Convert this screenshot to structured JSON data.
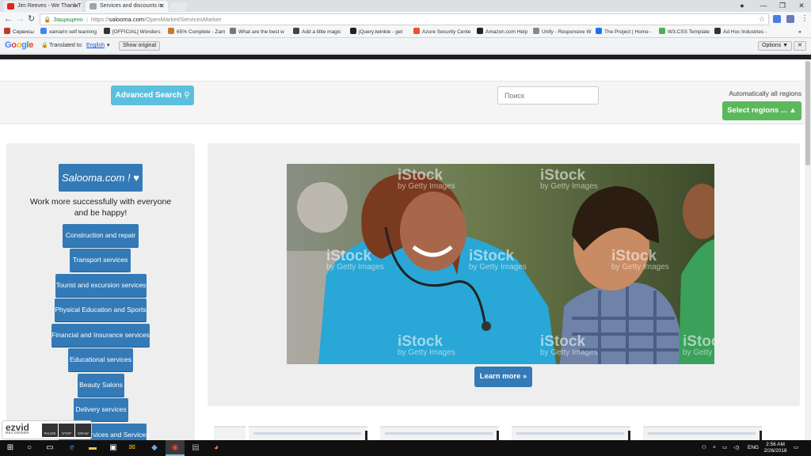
{
  "browser": {
    "tabs": [
      {
        "title": "Jim Reeves - We Thank T",
        "active": false,
        "favicon_color": "#e62117"
      },
      {
        "title": "Services and discounts in",
        "active": true,
        "favicon_color": "#9aa5b1"
      }
    ],
    "url": {
      "secure_label": "Защищено",
      "scheme": "https://",
      "host": "salooma.com",
      "path": "/OpenMarket/ServicesMarket"
    },
    "bookmarks": [
      {
        "label": "Сервисы",
        "icon_color": "#c0392b"
      },
      {
        "label": "xamarin self learning",
        "icon_color": "#4285f4"
      },
      {
        "label": "[OFFICIAL] Wonders",
        "icon_color": "#333333"
      },
      {
        "label": "65% Complete - Zam",
        "icon_color": "#c97b2a"
      },
      {
        "label": "What are the best w",
        "icon_color": "#777777"
      },
      {
        "label": "Add a little magic",
        "icon_color": "#444444"
      },
      {
        "label": "jQuery.twinkle - get",
        "icon_color": "#222222"
      },
      {
        "label": "Azure Security Cente",
        "icon_color": "#f25022"
      },
      {
        "label": "Amazon.com Help",
        "icon_color": "#222222"
      },
      {
        "label": "Unify - Responsive W",
        "icon_color": "#888888"
      },
      {
        "label": "The Project | Home -",
        "icon_color": "#1a73e8"
      },
      {
        "label": "W3.CSS Template",
        "icon_color": "#4caf50"
      },
      {
        "label": "Ad Hoc Industries -",
        "icon_color": "#333333"
      }
    ],
    "translate": {
      "translated_to": "Translated to:",
      "language": "English",
      "show_original": "Show original",
      "options": "Options ▼"
    }
  },
  "page": {
    "advanced_search_label": "Advanced Search",
    "search_placeholder": "Поиск",
    "regions_label": "Automatically all regions",
    "select_regions_label": "Select regions ...",
    "brand_label": "Salooma.com !",
    "tagline": "Work more successfully with everyone and be happy!",
    "categories": [
      "Construction and repair",
      "Transport services",
      "Tourist and excursion services",
      "Physical Education and Sports",
      "Financial and Insurance services",
      "Educational services",
      "Beauty Salons",
      "Delivery services",
      "Medical services and Services"
    ],
    "hero_watermark": "iStock",
    "hero_watermark_sub": "by Getty Images",
    "learn_more_label": "Learn more »"
  },
  "recorder": {
    "logo": "ezvid",
    "sub": "RECORDER",
    "buttons": [
      "PAUSE",
      "STOP",
      "DRAW"
    ]
  },
  "taskbar": {
    "language": "ENG",
    "time": "2:56 AM",
    "date": "2/26/2018"
  },
  "colors": {
    "primary": "#337ab7",
    "info": "#5bc0de",
    "success": "#5cb85c"
  }
}
